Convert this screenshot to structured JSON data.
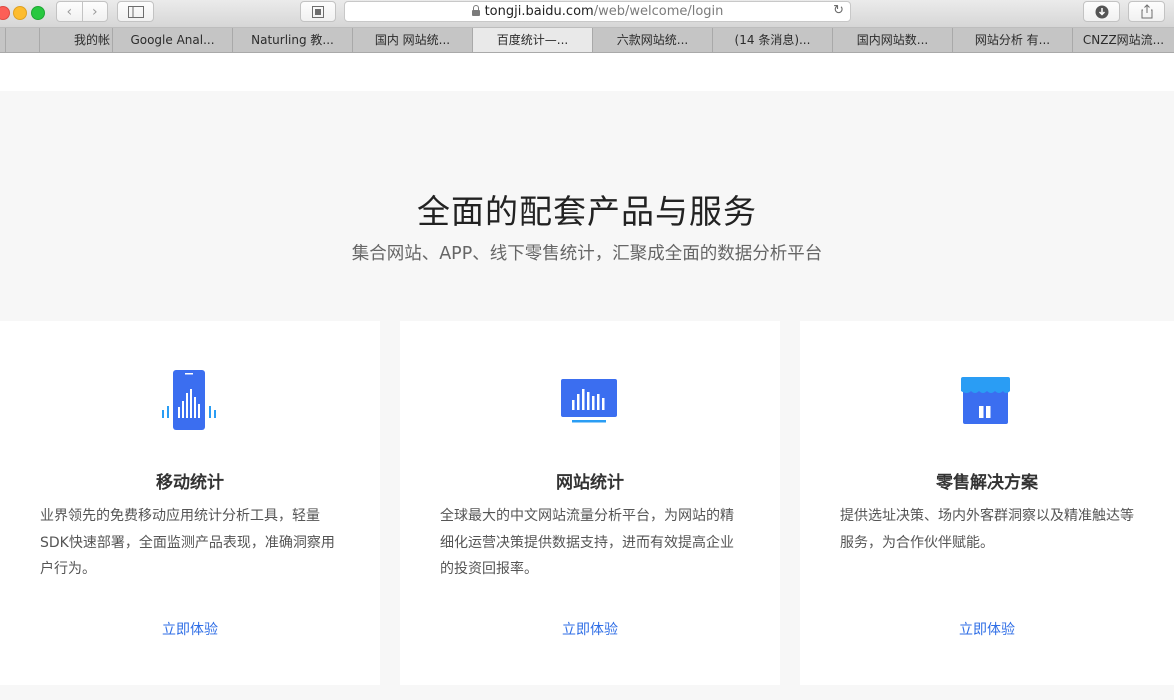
{
  "browser": {
    "url_host": "tongji.baidu.com",
    "url_path": "/web/welcome/login",
    "tabs": [
      {
        "label": "我的帐"
      },
      {
        "label": "Google Anal..."
      },
      {
        "label": "Naturling 教..."
      },
      {
        "label": "国内 网站统..."
      },
      {
        "label": "百度统计—..."
      },
      {
        "label": "六款网站统..."
      },
      {
        "label": "(14 条消息)..."
      },
      {
        "label": "国内网站数..."
      },
      {
        "label": "网站分析 有..."
      },
      {
        "label": "CNZZ网站流..."
      }
    ]
  },
  "hero": {
    "title": "全面的配套产品与服务",
    "subtitle": "集合网站、APP、线下零售统计，汇聚成全面的数据分析平台"
  },
  "cards": [
    {
      "icon": "mobile-analytics-icon",
      "title": "移动统计",
      "desc": "业界领先的免费移动应用统计分析工具，轻量SDK快速部署，全面监测产品表现，准确洞察用户行为。",
      "link": "立即体验"
    },
    {
      "icon": "web-analytics-icon",
      "title": "网站统计",
      "desc": "全球最大的中文网站流量分析平台，为网站的精细化运营决策提供数据支持，进而有效提高企业的投资回报率。",
      "link": "立即体验"
    },
    {
      "icon": "retail-store-icon",
      "title": "零售解决方案",
      "desc": "提供选址决策、场内外客群洞察以及精准触达等服务，为合作伙伴赋能。",
      "link": "立即体验"
    }
  ],
  "colors": {
    "accent_blue": "#2f6ee6",
    "icon_blue": "#3b6ef0",
    "icon_light_blue": "#2a9df4"
  }
}
